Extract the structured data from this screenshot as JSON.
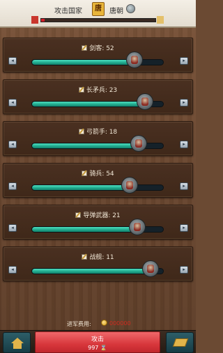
{
  "header": {
    "attack_country_label": "攻击国家",
    "emblem_char": "唐",
    "country_name": "唐朝",
    "hp_left_flag": "",
    "hp_right_flag": "",
    "hp_fraction": 0.03
  },
  "units": [
    {
      "name": "剑客: 52",
      "fraction": 0.78,
      "icon": "swordsman-portrait-icon"
    },
    {
      "name": "长矛兵: 23",
      "fraction": 0.86,
      "icon": "spearman-portrait-icon"
    },
    {
      "name": "弓箭手: 18",
      "fraction": 0.81,
      "icon": "archer-portrait-icon"
    },
    {
      "name": "骑兵: 54",
      "fraction": 0.74,
      "icon": "cavalry-portrait-icon"
    },
    {
      "name": "导弹武器: 21",
      "fraction": 0.8,
      "icon": "missile-weapon-icon"
    },
    {
      "name": "战舰: 11",
      "fraction": 0.9,
      "icon": "warship-icon"
    }
  ],
  "cost": {
    "label": "进军费用:",
    "value": "000000"
  },
  "footer": {
    "attack_label": "攻击",
    "attack_sub": "997 ⌛"
  },
  "colors": {
    "slider_fill": "#1ea58a",
    "attack_button": "#d8373c",
    "hp_bar": "#d11c27"
  }
}
